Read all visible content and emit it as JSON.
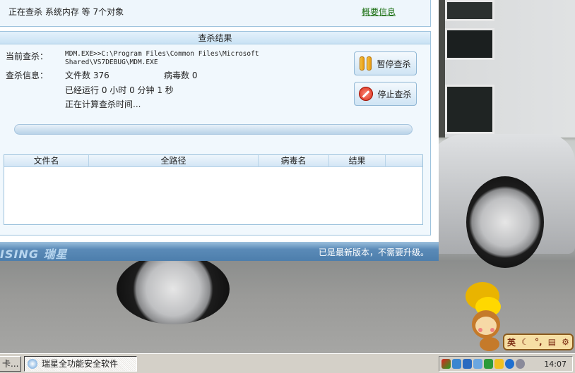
{
  "top": {
    "status": "正在查杀 系统内存 等 7个对象",
    "summary_link": "概要信息"
  },
  "results": {
    "title": "查杀结果",
    "current_label": "当前查杀：",
    "current_value": "MDM.EXE>>C:\\Program Files\\Common Files\\Microsoft Shared\\VS7DEBUG\\MDM.EXE",
    "info_label": "查杀信息：",
    "files": "文件数 376",
    "viruses": "病毒数 0",
    "elapsed": "已经运行 0 小时 0 分钟 1  秒",
    "estimating": "正在计算查杀时间...",
    "pause_button": "暂停查杀",
    "stop_button": "停止查杀",
    "progress": 0,
    "columns": [
      "文件名",
      "全路径",
      "病毒名",
      "结果"
    ]
  },
  "footer": {
    "logo": "ISING 瑞星",
    "update_status": "已是最新版本，不需要升级。"
  },
  "ime": {
    "mode": "英"
  },
  "taskbar": {
    "prev_item": "卡...",
    "active_item": "瑞星全功能安全软件",
    "clock": "14:07"
  }
}
